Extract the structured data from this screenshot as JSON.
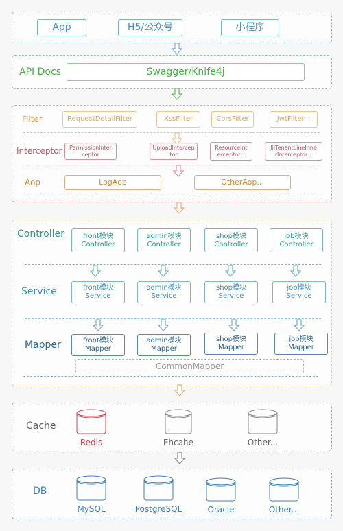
{
  "colors": {
    "client": "#4a90c8",
    "api": "#3dba3d",
    "filter": "#e8a24a",
    "interceptor": "#d0505c",
    "aop": "#d9892e",
    "controller": "#2a9a95",
    "service": "#3e8fd0",
    "mapper": "#2e6699",
    "common": "#9a9a9a",
    "cache": "#666666",
    "redis": "#d9454f",
    "db": "#3a82c0"
  },
  "clients": {
    "items": [
      "App",
      "H5/公众号",
      "小程序"
    ]
  },
  "api_docs": {
    "label": "API Docs",
    "tool": "Swagger/Knife4j"
  },
  "filter": {
    "label": "Filter",
    "items": [
      "RequestDetailFilter",
      "XssFilter",
      "CorsFilter",
      "JwtFilter..."
    ]
  },
  "interceptor": {
    "label": "Interceptor",
    "items": [
      "PermissionInter\nceptor",
      "UploadIntercep\ntor",
      "ResourceInt\nerceptor...",
      "JjjTenantLineInne\nrInterceptor..."
    ]
  },
  "aop": {
    "label": "Aop",
    "items": [
      "LogAop",
      "OtherAop..."
    ]
  },
  "controller": {
    "label": "Controller",
    "items": [
      "front模块\nController",
      "admin模块\nController",
      "shop模块\nController",
      "job模块\nController"
    ]
  },
  "service": {
    "label": "Service",
    "items": [
      "front模块\nService",
      "admin模块\nService",
      "shop模块\nService",
      "job模块\nService"
    ]
  },
  "mapper": {
    "label": "Mapper",
    "items": [
      "front模块\nMapper",
      "admin模块\nMapper",
      "shop模块\nMapper",
      "job模块\nMapper"
    ],
    "common": "CommonMapper"
  },
  "cache": {
    "label": "Cache",
    "items": [
      "Redis",
      "Ehcahe",
      "Other..."
    ]
  },
  "db": {
    "label": "DB",
    "items": [
      "MySQL",
      "PostgreSQL",
      "Oracle",
      "Other..."
    ]
  }
}
